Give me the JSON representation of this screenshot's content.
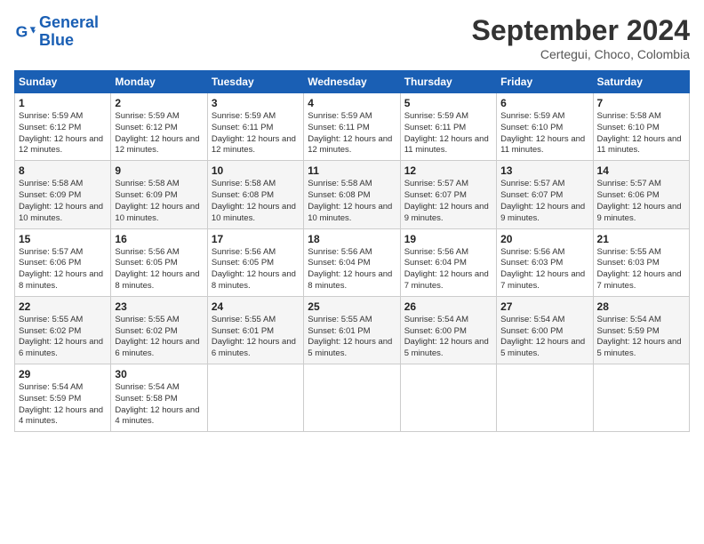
{
  "logo": {
    "line1": "General",
    "line2": "Blue"
  },
  "title": "September 2024",
  "subtitle": "Certegui, Choco, Colombia",
  "days_of_week": [
    "Sunday",
    "Monday",
    "Tuesday",
    "Wednesday",
    "Thursday",
    "Friday",
    "Saturday"
  ],
  "weeks": [
    [
      {
        "day": 1,
        "sunrise": "Sunrise: 5:59 AM",
        "sunset": "Sunset: 6:12 PM",
        "daylight": "Daylight: 12 hours and 12 minutes."
      },
      {
        "day": 2,
        "sunrise": "Sunrise: 5:59 AM",
        "sunset": "Sunset: 6:12 PM",
        "daylight": "Daylight: 12 hours and 12 minutes."
      },
      {
        "day": 3,
        "sunrise": "Sunrise: 5:59 AM",
        "sunset": "Sunset: 6:11 PM",
        "daylight": "Daylight: 12 hours and 12 minutes."
      },
      {
        "day": 4,
        "sunrise": "Sunrise: 5:59 AM",
        "sunset": "Sunset: 6:11 PM",
        "daylight": "Daylight: 12 hours and 12 minutes."
      },
      {
        "day": 5,
        "sunrise": "Sunrise: 5:59 AM",
        "sunset": "Sunset: 6:11 PM",
        "daylight": "Daylight: 12 hours and 11 minutes."
      },
      {
        "day": 6,
        "sunrise": "Sunrise: 5:59 AM",
        "sunset": "Sunset: 6:10 PM",
        "daylight": "Daylight: 12 hours and 11 minutes."
      },
      {
        "day": 7,
        "sunrise": "Sunrise: 5:58 AM",
        "sunset": "Sunset: 6:10 PM",
        "daylight": "Daylight: 12 hours and 11 minutes."
      }
    ],
    [
      {
        "day": 8,
        "sunrise": "Sunrise: 5:58 AM",
        "sunset": "Sunset: 6:09 PM",
        "daylight": "Daylight: 12 hours and 10 minutes."
      },
      {
        "day": 9,
        "sunrise": "Sunrise: 5:58 AM",
        "sunset": "Sunset: 6:09 PM",
        "daylight": "Daylight: 12 hours and 10 minutes."
      },
      {
        "day": 10,
        "sunrise": "Sunrise: 5:58 AM",
        "sunset": "Sunset: 6:08 PM",
        "daylight": "Daylight: 12 hours and 10 minutes."
      },
      {
        "day": 11,
        "sunrise": "Sunrise: 5:58 AM",
        "sunset": "Sunset: 6:08 PM",
        "daylight": "Daylight: 12 hours and 10 minutes."
      },
      {
        "day": 12,
        "sunrise": "Sunrise: 5:57 AM",
        "sunset": "Sunset: 6:07 PM",
        "daylight": "Daylight: 12 hours and 9 minutes."
      },
      {
        "day": 13,
        "sunrise": "Sunrise: 5:57 AM",
        "sunset": "Sunset: 6:07 PM",
        "daylight": "Daylight: 12 hours and 9 minutes."
      },
      {
        "day": 14,
        "sunrise": "Sunrise: 5:57 AM",
        "sunset": "Sunset: 6:06 PM",
        "daylight": "Daylight: 12 hours and 9 minutes."
      }
    ],
    [
      {
        "day": 15,
        "sunrise": "Sunrise: 5:57 AM",
        "sunset": "Sunset: 6:06 PM",
        "daylight": "Daylight: 12 hours and 8 minutes."
      },
      {
        "day": 16,
        "sunrise": "Sunrise: 5:56 AM",
        "sunset": "Sunset: 6:05 PM",
        "daylight": "Daylight: 12 hours and 8 minutes."
      },
      {
        "day": 17,
        "sunrise": "Sunrise: 5:56 AM",
        "sunset": "Sunset: 6:05 PM",
        "daylight": "Daylight: 12 hours and 8 minutes."
      },
      {
        "day": 18,
        "sunrise": "Sunrise: 5:56 AM",
        "sunset": "Sunset: 6:04 PM",
        "daylight": "Daylight: 12 hours and 8 minutes."
      },
      {
        "day": 19,
        "sunrise": "Sunrise: 5:56 AM",
        "sunset": "Sunset: 6:04 PM",
        "daylight": "Daylight: 12 hours and 7 minutes."
      },
      {
        "day": 20,
        "sunrise": "Sunrise: 5:56 AM",
        "sunset": "Sunset: 6:03 PM",
        "daylight": "Daylight: 12 hours and 7 minutes."
      },
      {
        "day": 21,
        "sunrise": "Sunrise: 5:55 AM",
        "sunset": "Sunset: 6:03 PM",
        "daylight": "Daylight: 12 hours and 7 minutes."
      }
    ],
    [
      {
        "day": 22,
        "sunrise": "Sunrise: 5:55 AM",
        "sunset": "Sunset: 6:02 PM",
        "daylight": "Daylight: 12 hours and 6 minutes."
      },
      {
        "day": 23,
        "sunrise": "Sunrise: 5:55 AM",
        "sunset": "Sunset: 6:02 PM",
        "daylight": "Daylight: 12 hours and 6 minutes."
      },
      {
        "day": 24,
        "sunrise": "Sunrise: 5:55 AM",
        "sunset": "Sunset: 6:01 PM",
        "daylight": "Daylight: 12 hours and 6 minutes."
      },
      {
        "day": 25,
        "sunrise": "Sunrise: 5:55 AM",
        "sunset": "Sunset: 6:01 PM",
        "daylight": "Daylight: 12 hours and 5 minutes."
      },
      {
        "day": 26,
        "sunrise": "Sunrise: 5:54 AM",
        "sunset": "Sunset: 6:00 PM",
        "daylight": "Daylight: 12 hours and 5 minutes."
      },
      {
        "day": 27,
        "sunrise": "Sunrise: 5:54 AM",
        "sunset": "Sunset: 6:00 PM",
        "daylight": "Daylight: 12 hours and 5 minutes."
      },
      {
        "day": 28,
        "sunrise": "Sunrise: 5:54 AM",
        "sunset": "Sunset: 5:59 PM",
        "daylight": "Daylight: 12 hours and 5 minutes."
      }
    ],
    [
      {
        "day": 29,
        "sunrise": "Sunrise: 5:54 AM",
        "sunset": "Sunset: 5:59 PM",
        "daylight": "Daylight: 12 hours and 4 minutes."
      },
      {
        "day": 30,
        "sunrise": "Sunrise: 5:54 AM",
        "sunset": "Sunset: 5:58 PM",
        "daylight": "Daylight: 12 hours and 4 minutes."
      },
      null,
      null,
      null,
      null,
      null
    ]
  ]
}
